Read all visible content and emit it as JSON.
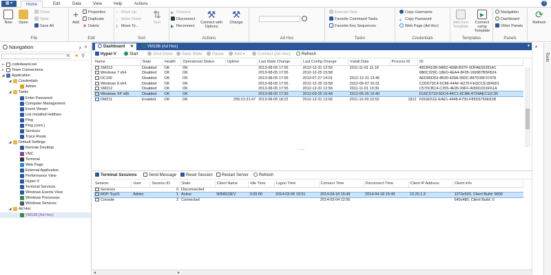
{
  "app_menu": "▦ ▾",
  "tabs": [
    "Home",
    "Edit",
    "Data",
    "View",
    "Help",
    "Actions"
  ],
  "ribbon": {
    "file": {
      "label": "File",
      "new": "New",
      "open": "Open",
      "close": "Close",
      "save": "Save",
      "save_all": "Save All"
    },
    "edit": {
      "label": "Edit",
      "add": "Add",
      "properties": "Properties",
      "duplicate": "Duplicate",
      "delete": "Delete"
    },
    "sort": {
      "label": "Sort",
      "move_up": "Move Up",
      "move_down": "Move Down",
      "move_to": "Move To...",
      "sort": "Sort"
    },
    "actions": {
      "label": "Actions",
      "connect": "Connect",
      "disconnect": "Disconnect",
      "reconnect": "Reconnect",
      "connect_with_options": "Connect with Options",
      "change": "Change"
    },
    "adhoc": {
      "label": "Ad Hoc",
      "input_value": ""
    },
    "tasks": {
      "label": "Tasks",
      "execute_task": "Execute Task",
      "favorite_command_tasks": "Favorite Command Tasks",
      "favorite_key_sequences": "Favorite Key Sequences"
    },
    "credentials": {
      "label": "Credentials",
      "copy_username": "Copy Username",
      "copy_password": "Copy Password",
      "web_page_adhoc": "Web Page (Ad Hoc)"
    },
    "templates": {
      "label": "Templates",
      "add_from_template": "Add from Template",
      "connect_using_template": "Connect using Template"
    },
    "panels": {
      "label": "Panels",
      "navigation": "Navigation",
      "dashboard": "Dashboard",
      "other_panels": "Other Panels"
    },
    "refresh": "Refresh"
  },
  "nav": {
    "title": "Navigation",
    "pin": "ꭗ",
    "close": "✕",
    "tree": [
      {
        "label": "code4ward.net",
        "level": 0,
        "expander": "▸",
        "icon": "folder-icon",
        "color": "#ffffff"
      },
      {
        "label": "Team Connections",
        "level": 0,
        "expander": "▸",
        "icon": "folder-icon",
        "color": "#ffffff"
      },
      {
        "label": "Application",
        "level": 0,
        "expander": "◢",
        "icon": "app-icon",
        "color": "#4a6fa5"
      },
      {
        "label": "Credentials",
        "level": 1,
        "expander": "◢",
        "icon": "folder-icon",
        "color": "#e8b84a"
      },
      {
        "label": "Admin",
        "level": 2,
        "expander": "",
        "icon": "key-icon",
        "color": "#d9a400"
      },
      {
        "label": "Tasks",
        "level": 1,
        "expander": "◢",
        "icon": "folder-icon",
        "color": "#e8b84a"
      },
      {
        "label": "Enter Password",
        "level": 2,
        "expander": "",
        "icon": "task-icon",
        "color": "#2b579a"
      },
      {
        "label": "Computer Management",
        "level": 2,
        "expander": "",
        "icon": "task-icon",
        "color": "#2b579a"
      },
      {
        "label": "Event Viewer",
        "level": 2,
        "expander": "",
        "icon": "task-icon",
        "color": "#2b579a"
      },
      {
        "label": "List Installed Hotfixes",
        "level": 2,
        "expander": "",
        "icon": "task-icon",
        "color": "#2b579a"
      },
      {
        "label": "Ping",
        "level": 2,
        "expander": "",
        "icon": "task-icon",
        "color": "#2b579a"
      },
      {
        "label": "Ping (cont.)",
        "level": 2,
        "expander": "",
        "icon": "task-icon",
        "color": "#2b579a"
      },
      {
        "label": "Services",
        "level": 2,
        "expander": "",
        "icon": "task-icon",
        "color": "#2b579a"
      },
      {
        "label": "Trace Route",
        "level": 2,
        "expander": "",
        "icon": "task-icon",
        "color": "#2b579a"
      },
      {
        "label": "Default Settings",
        "level": 1,
        "expander": "◢",
        "icon": "folder-icon",
        "color": "#e8b84a"
      },
      {
        "label": "Remote Desktop",
        "level": 2,
        "expander": "",
        "icon": "remote-desktop-icon",
        "color": "#2b579a"
      },
      {
        "label": "VNC",
        "level": 2,
        "expander": "",
        "icon": "vnc-icon",
        "color": "#8a3fa0"
      },
      {
        "label": "Terminal",
        "level": 2,
        "expander": "",
        "icon": "terminal-icon",
        "color": "#333333"
      },
      {
        "label": "Web Page",
        "level": 2,
        "expander": "",
        "icon": "web-icon",
        "color": "#2b8ae0"
      },
      {
        "label": "External Application",
        "level": 2,
        "expander": "",
        "icon": "external-app-icon",
        "color": "#2b579a"
      },
      {
        "label": "Performance View",
        "level": 2,
        "expander": "",
        "icon": "performance-icon",
        "color": "#2b579a"
      },
      {
        "label": "Hyper-V",
        "level": 2,
        "expander": "",
        "icon": "hyperv-icon",
        "color": "#2b579a"
      },
      {
        "label": "Terminal Services",
        "level": 2,
        "expander": "",
        "icon": "terminal-services-icon",
        "color": "#2b579a"
      },
      {
        "label": "Windows Events View",
        "level": 2,
        "expander": "",
        "icon": "events-icon",
        "color": "#2b579a"
      },
      {
        "label": "Windows Processes",
        "level": 2,
        "expander": "",
        "icon": "processes-icon",
        "color": "#2e8b57"
      },
      {
        "label": "Windows Services",
        "level": 2,
        "expander": "",
        "icon": "services-icon",
        "color": "#555555"
      },
      {
        "label": "Ad Hoc",
        "level": 1,
        "expander": "◢",
        "icon": "folder-icon",
        "color": "#e8b84a"
      },
      {
        "label": "VM198 (Ad Hoc)",
        "level": 2,
        "expander": "",
        "icon": "remote-desktop-icon",
        "color": "#2e8b57",
        "selected": true
      }
    ]
  },
  "doc_tabs": [
    {
      "label": "Dashboard",
      "close": "✕",
      "active": true
    },
    {
      "label": "VM198 (Ad Hoc)",
      "close": "",
      "active": false
    }
  ],
  "hyperv_toolbar": {
    "title": "Hyper-V",
    "start": "Start",
    "shut_down": "Shut Down",
    "save_state": "Save State",
    "pause": "Pause",
    "add": "Add",
    "connect_adhoc": "Connect (Ad Hoc)",
    "refresh": "Refresh"
  },
  "vm_table": {
    "columns": [
      "Name",
      "State",
      "Health",
      "Operational Status",
      "Uptime",
      "Last State Change",
      "Last Config Change",
      "Install Date",
      "Process ID",
      "ID"
    ],
    "rows": [
      [
        "SM213",
        "Disabled",
        "OK",
        "OK",
        "",
        "2013-08-05 17:55",
        "2012-12-31 12:56",
        "2011-11-01 11:16",
        "",
        "4B1B410B-0AB2-4588-B97F-0DFAE55281A1"
      ],
      [
        "Windows 7 x64",
        "Disabled",
        "OK",
        "OK",
        "",
        "2013-08-05 17:55",
        "2012-12-25 15:58",
        "",
        "",
        "6B0C329C-18ED-4EA4-8F05-169987B5FB24"
      ],
      [
        "DC100",
        "Disabled",
        "OK",
        "OK",
        "",
        "2013-08-05 17:55",
        "2013-07-27 14:01",
        "2012-12-31 13:46",
        "",
        "AED86D63-4B30-428A-950C-887D38F37478"
      ],
      [
        "Windows 8 x64",
        "Disabled",
        "OK",
        "OK",
        "",
        "2013-08-05 17:55",
        "2012-12-25 15:58",
        "2012-09-07 16:31",
        "",
        "C2DD73C4-5C86-44AF-A276-FEDCCE1B4001"
      ],
      [
        "SM212",
        "Disabled",
        "OK",
        "OK",
        "",
        "2013-08-05 17:55",
        "2012-12-31 12:56",
        "2011-11-01 10:36",
        "",
        "C570CBC4-C255-4E95-99FF-A9991D16F61A"
      ],
      [
        "Windows XP x86",
        "Disabled",
        "OK",
        "OK",
        "",
        "2013-08-05 17:55",
        "2012-09-25 16:48",
        "2012-05-26 16:40",
        "",
        "D16C5719-5DC4-44C1-8CAB-4724AEC11C35"
      ],
      [
        "DM211",
        "Enabled",
        "OK",
        "OK",
        "255:21:31:47",
        "2013-08-05 18:22",
        "2012-12-31 12:56",
        "2011-10-29 10:52",
        "1812",
        "F816E51E-EAE1-4448-A759-F85D6750E81B"
      ]
    ],
    "selected_row": 5
  },
  "splitter": ".....",
  "ts_toolbar": {
    "title": "Terminal Sessions",
    "send_message": "Send Message",
    "reset_session": "Reset Session",
    "restart_server": "Restart Server",
    "refresh": "Refresh"
  },
  "ts_table": {
    "columns": [
      "Session",
      "User",
      "Session ID",
      "State",
      "Client Name",
      "Idle Time",
      "Logon Time",
      "Connect Time",
      "Disconnect Time",
      "Client IP Address",
      "Client Info"
    ],
    "rows": [
      [
        "Services",
        "",
        "0",
        "Disconnected",
        "",
        "",
        "",
        "",
        "",
        "",
        ""
      ],
      [
        "RDP-Tcp#1",
        "Admin",
        "1",
        "Active",
        "WIN81DEV",
        "0.00:00",
        "2014-03-06 10:51",
        "2014-04-18 15:49",
        "2014-04-18 15:49",
        "10.25.1.3",
        "1270x503, Client Build: 9600"
      ],
      [
        "Console",
        "",
        "2",
        "Connected",
        "",
        "",
        "",
        "2014-03-04 12:56",
        "",
        "",
        "640x480, Client Build: 0"
      ]
    ],
    "selected_row": 1
  },
  "right_tools_label": "Tools",
  "scroll": {
    "left": "◂",
    "right": "▸",
    "up": "▴"
  }
}
